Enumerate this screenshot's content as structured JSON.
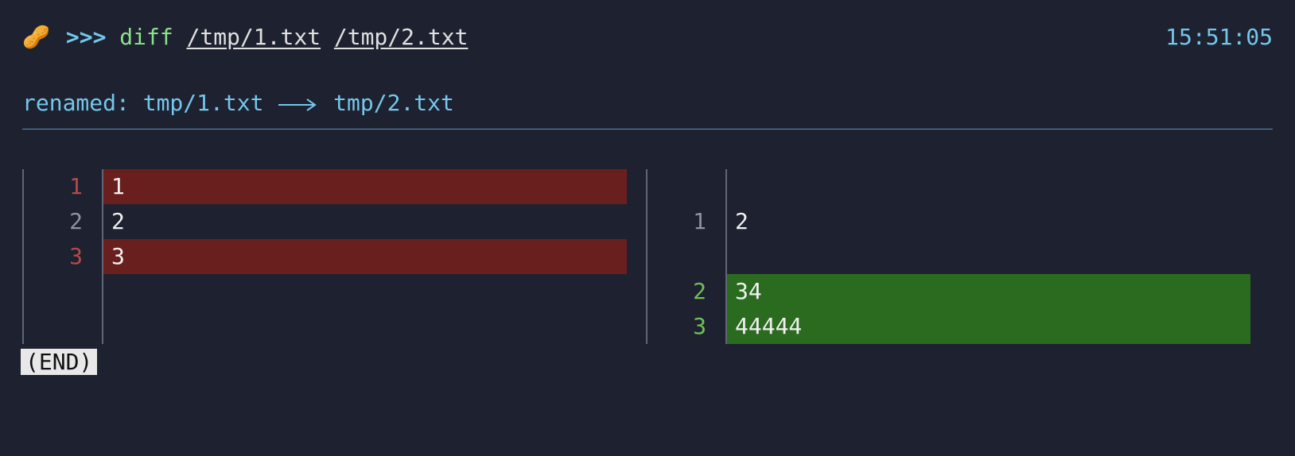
{
  "prompt": {
    "emoji": "🥜",
    "symbol": ">>>",
    "command": "diff",
    "args": [
      "/tmp/1.txt",
      "/tmp/2.txt"
    ]
  },
  "timestamp": "15:51:05",
  "renamed": {
    "label": "renamed:",
    "from": "tmp/1.txt",
    "to": "tmp/2.txt"
  },
  "diff": {
    "left": [
      {
        "num": "1",
        "text": "1",
        "kind": "del"
      },
      {
        "num": "2",
        "text": "2",
        "kind": "ctx"
      },
      {
        "num": "3",
        "text": "3",
        "kind": "del"
      },
      {
        "num": "",
        "text": "",
        "kind": "empty"
      },
      {
        "num": "",
        "text": "",
        "kind": "empty"
      }
    ],
    "right": [
      {
        "num": "",
        "text": "",
        "kind": "empty"
      },
      {
        "num": "1",
        "text": "2",
        "kind": "ctx"
      },
      {
        "num": "",
        "text": "",
        "kind": "empty"
      },
      {
        "num": "2",
        "text": "34",
        "kind": "add"
      },
      {
        "num": "3",
        "text": "44444",
        "kind": "add"
      }
    ]
  },
  "pager_end": "(END)"
}
